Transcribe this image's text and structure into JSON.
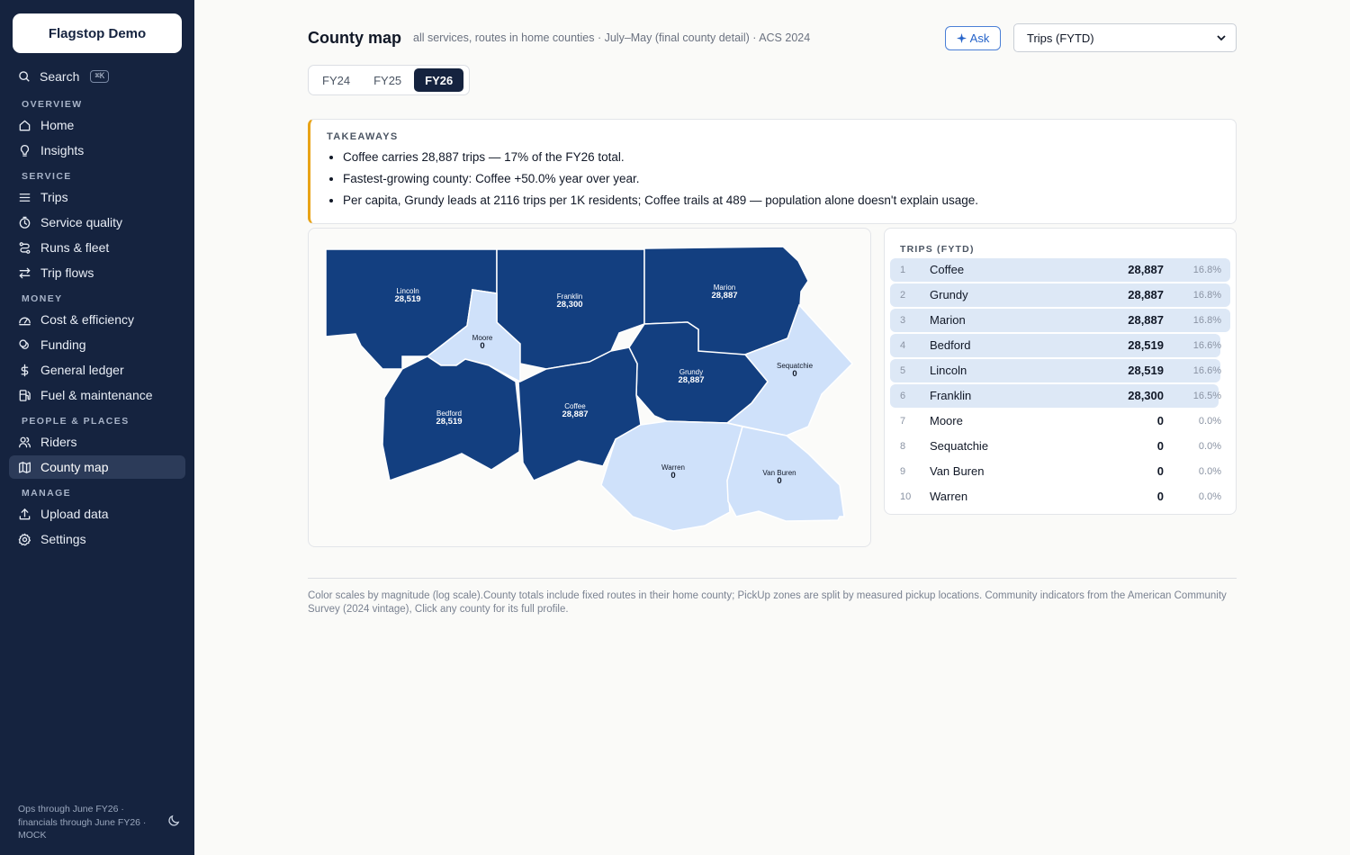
{
  "app": {
    "name": "Flagstop Demo"
  },
  "search": {
    "label": "Search",
    "shortcut": "⌘K"
  },
  "nav": {
    "sections": [
      {
        "title": "OVERVIEW",
        "items": [
          {
            "label": "Home",
            "icon": "home-icon"
          },
          {
            "label": "Insights",
            "icon": "lightbulb-icon"
          }
        ]
      },
      {
        "title": "SERVICE",
        "items": [
          {
            "label": "Trips",
            "icon": "list-icon"
          },
          {
            "label": "Service quality",
            "icon": "clock-icon"
          },
          {
            "label": "Runs & fleet",
            "icon": "route-icon"
          },
          {
            "label": "Trip flows",
            "icon": "arrows-icon"
          }
        ]
      },
      {
        "title": "MONEY",
        "items": [
          {
            "label": "Cost & efficiency",
            "icon": "gauge-icon"
          },
          {
            "label": "Funding",
            "icon": "coins-icon"
          },
          {
            "label": "General ledger",
            "icon": "dollar-icon"
          },
          {
            "label": "Fuel & maintenance",
            "icon": "fuel-icon"
          }
        ]
      },
      {
        "title": "PEOPLE & PLACES",
        "items": [
          {
            "label": "Riders",
            "icon": "users-icon"
          },
          {
            "label": "County map",
            "icon": "map-icon",
            "active": true
          }
        ]
      },
      {
        "title": "MANAGE",
        "items": [
          {
            "label": "Upload data",
            "icon": "upload-icon"
          },
          {
            "label": "Settings",
            "icon": "gear-icon"
          }
        ]
      }
    ]
  },
  "footer": {
    "text": "Ops through June FY26 · financials through June FY26 · MOCK"
  },
  "header": {
    "title": "County map",
    "subtitle": "all services, routes in home counties · July–May (final county detail) · ACS 2024",
    "ask_label": "Ask",
    "metric_selected": "Trips (FYTD)"
  },
  "fiscal_years": [
    {
      "label": "FY24",
      "active": false
    },
    {
      "label": "FY25",
      "active": false
    },
    {
      "label": "FY26",
      "active": true
    }
  ],
  "takeaways": {
    "title": "TAKEAWAYS",
    "items": [
      "Coffee carries 28,887 trips — 17% of the FY26 total.",
      "Fastest-growing county: Coffee +50.0% year over year.",
      "Per capita, Grundy leads at 2116 trips per 1K residents; Coffee trails at 489 — population alone doesn't explain usage."
    ]
  },
  "map": {
    "counties": [
      {
        "name": "Lincoln",
        "value": "28,519",
        "shade": "dark"
      },
      {
        "name": "Franklin",
        "value": "28,300",
        "shade": "dark"
      },
      {
        "name": "Marion",
        "value": "28,887",
        "shade": "dark"
      },
      {
        "name": "Moore",
        "value": "0",
        "shade": "light"
      },
      {
        "name": "Sequatchie",
        "value": "0",
        "shade": "light"
      },
      {
        "name": "Grundy",
        "value": "28,887",
        "shade": "dark"
      },
      {
        "name": "Bedford",
        "value": "28,519",
        "shade": "dark"
      },
      {
        "name": "Coffee",
        "value": "28,887",
        "shade": "dark"
      },
      {
        "name": "Warren",
        "value": "0",
        "shade": "light"
      },
      {
        "name": "Van Buren",
        "value": "0",
        "shade": "light"
      }
    ],
    "colors": {
      "high": "#133f80",
      "low": "#cfe1fa"
    }
  },
  "ranking": {
    "title": "TRIPS (FYTD)",
    "rows": [
      {
        "rank": "1",
        "name": "Coffee",
        "value": "28,887",
        "pct": "16.8%",
        "share": 0.168
      },
      {
        "rank": "2",
        "name": "Grundy",
        "value": "28,887",
        "pct": "16.8%",
        "share": 0.168
      },
      {
        "rank": "3",
        "name": "Marion",
        "value": "28,887",
        "pct": "16.8%",
        "share": 0.168
      },
      {
        "rank": "4",
        "name": "Bedford",
        "value": "28,519",
        "pct": "16.6%",
        "share": 0.166
      },
      {
        "rank": "5",
        "name": "Lincoln",
        "value": "28,519",
        "pct": "16.6%",
        "share": 0.166
      },
      {
        "rank": "6",
        "name": "Franklin",
        "value": "28,300",
        "pct": "16.5%",
        "share": 0.165
      },
      {
        "rank": "7",
        "name": "Moore",
        "value": "0",
        "pct": "0.0%",
        "share": 0
      },
      {
        "rank": "8",
        "name": "Sequatchie",
        "value": "0",
        "pct": "0.0%",
        "share": 0
      },
      {
        "rank": "9",
        "name": "Van Buren",
        "value": "0",
        "pct": "0.0%",
        "share": 0
      },
      {
        "rank": "10",
        "name": "Warren",
        "value": "0",
        "pct": "0.0%",
        "share": 0
      }
    ]
  },
  "note": "Color scales by magnitude (log scale).County totals include fixed routes in their home county; PickUp zones are split by measured pickup locations. Community indicators from the American Community Survey (2024 vintage), Click any county for its full profile."
}
